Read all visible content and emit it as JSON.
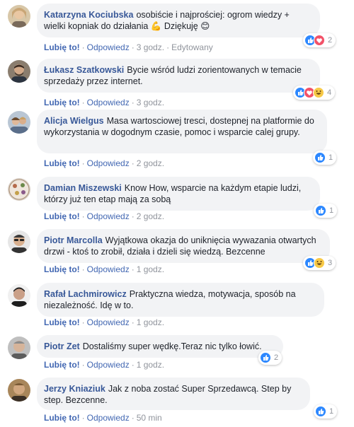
{
  "actions": {
    "like": "Lubię to!",
    "reply": "Odpowiedz",
    "sep": "·",
    "edited": "Edytowany"
  },
  "colors": {
    "author": "#385898",
    "action_link": "#4267b2",
    "bubble": "#f2f3f5",
    "meta": "#90949c"
  },
  "comments": [
    {
      "author": "Katarzyna Kociubska",
      "text": "osobiście i najprościej: ogrom wiedzy + wielki kopniak do działania 💪 Dziękuję 😊",
      "time": "3 godz.",
      "edited": true,
      "reaction_icons": [
        "like-icon",
        "love-icon"
      ],
      "reaction_count": "2"
    },
    {
      "author": "Łukasz Szatkowski",
      "text": "Bycie wśród ludzi zorientowanych w temacie sprzedaży przez internet.",
      "time": "3 godz.",
      "reaction_icons": [
        "like-icon",
        "love-icon",
        "haha-icon"
      ],
      "reaction_count": "4"
    },
    {
      "author": "Alicja Wielgus",
      "text": "Masa wartosciowej tresci, dostepnej na platformie do wykorzystania w dogodnym czasie, pomoc i wsparcie calej grupy.",
      "time": "2 godz.",
      "reaction_icons": [
        "like-icon"
      ],
      "reaction_count": "1"
    },
    {
      "author": "Damian Miszewski",
      "text": "Know How, wsparcie na każdym etapie ludzi, którzy już ten etap mają za sobą",
      "time": "2 godz.",
      "reaction_icons": [
        "like-icon"
      ],
      "reaction_count": "1"
    },
    {
      "author": "Piotr Marcolla",
      "text": "Wyjątkowa okazja do uniknięcia wywazania otwartych drzwi - ktoś to zrobił, działa i dzieli się wiedzą. Bezcenne",
      "time": "1 godz.",
      "reaction_icons": [
        "like-icon",
        "haha-icon"
      ],
      "reaction_count": "3"
    },
    {
      "author": "Rafał Lachmirowicz",
      "text": "Praktyczna wiedza, motywacja, sposób na niezależność. Idę w to.",
      "time": "1 godz.",
      "reaction_icons": [],
      "reaction_count": ""
    },
    {
      "author": "Piotr Zet",
      "text": "Dostaliśmy super wędkę.Teraz nic tylko łowić.",
      "time": "1 godz.",
      "reaction_icons": [
        "like-icon"
      ],
      "reaction_count": "2"
    },
    {
      "author": "Jerzy Kniaziuk",
      "text": "Jak z noba zostać Super Sprzedawcą. Step by step. Bezcenne.",
      "time": "50 min",
      "reaction_icons": [
        "like-icon"
      ],
      "reaction_count": "1"
    }
  ]
}
